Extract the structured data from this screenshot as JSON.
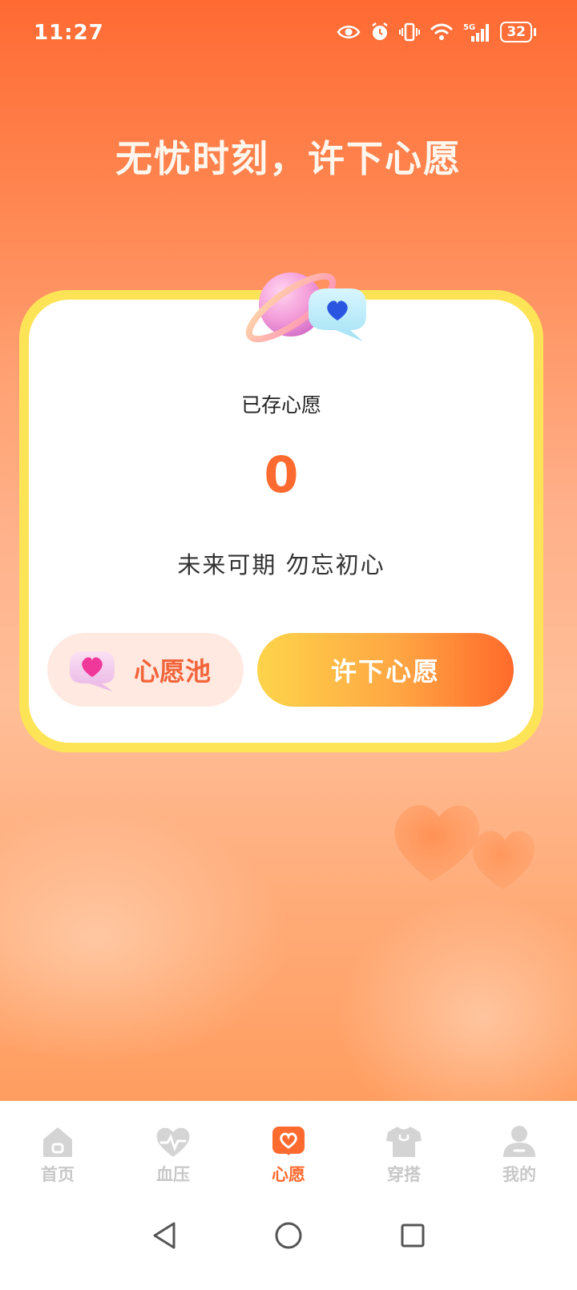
{
  "status_bar": {
    "time": "11:27",
    "battery": "32",
    "icons": [
      "eye-icon",
      "alarm-icon",
      "vibrate-icon",
      "wifi-icon",
      "signal-5g-icon",
      "battery-icon"
    ]
  },
  "headline": "无忧时刻，许下心愿",
  "card": {
    "saved_label": "已存心愿",
    "count": "0",
    "motto": "未来可期  勿忘初心",
    "pool_button": "心愿池",
    "wish_button": "许下心愿"
  },
  "tabs": [
    {
      "label": "首页",
      "icon": "home-icon",
      "active": false
    },
    {
      "label": "血压",
      "icon": "heart-pulse-icon",
      "active": false
    },
    {
      "label": "心愿",
      "icon": "wish-icon",
      "active": true
    },
    {
      "label": "穿搭",
      "icon": "shirt-icon",
      "active": false
    },
    {
      "label": "我的",
      "icon": "profile-icon",
      "active": false
    }
  ],
  "system_nav": [
    "back-icon",
    "home-circle-icon",
    "recents-icon"
  ],
  "colors": {
    "accent": "#ff6a2f",
    "card_border": "#fde457",
    "pool_bg": "#ffe9e1",
    "inactive_tab": "#c8c8c8"
  }
}
